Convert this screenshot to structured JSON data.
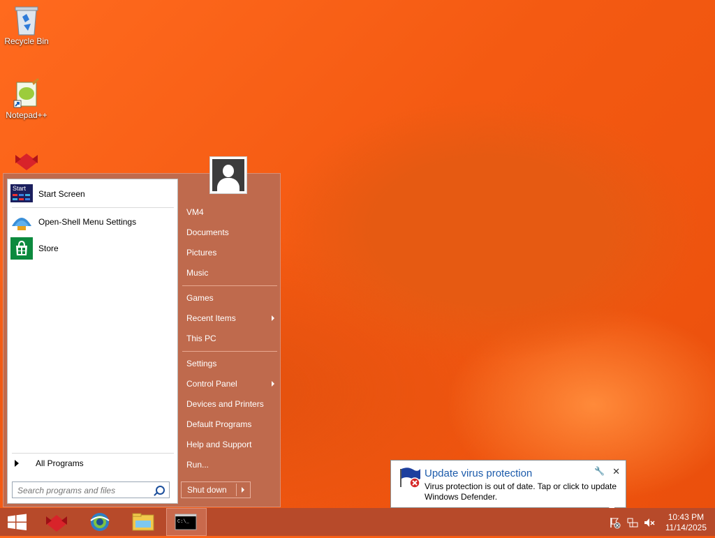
{
  "desktop": {
    "icons": [
      {
        "label": "Recycle Bin",
        "icon": "recycle-bin-icon"
      },
      {
        "label": "Notepad++",
        "icon": "notepad-plus-plus-icon"
      },
      {
        "label": "",
        "icon": "app-red-icon"
      }
    ]
  },
  "start_menu": {
    "pinned": [
      {
        "label": "Start Screen",
        "icon": "start-screen-icon"
      },
      {
        "label": "Open-Shell Menu Settings",
        "icon": "open-shell-icon"
      },
      {
        "label": "Store",
        "icon": "store-icon"
      }
    ],
    "start_tile_text": "Start",
    "all_programs": "All Programs",
    "search_placeholder": "Search programs and files",
    "right_items": [
      {
        "label": "VM4",
        "submenu": false
      },
      {
        "label": "Documents",
        "submenu": false
      },
      {
        "label": "Pictures",
        "submenu": false
      },
      {
        "label": "Music",
        "submenu": false
      },
      {
        "label": "Games",
        "submenu": false
      },
      {
        "label": "Recent Items",
        "submenu": true
      },
      {
        "label": "This PC",
        "submenu": false
      },
      {
        "label": "Settings",
        "submenu": false
      },
      {
        "label": "Control Panel",
        "submenu": true
      },
      {
        "label": "Devices and Printers",
        "submenu": false
      },
      {
        "label": "Default Programs",
        "submenu": false
      },
      {
        "label": "Help and Support",
        "submenu": false
      },
      {
        "label": "Run...",
        "submenu": false
      }
    ],
    "shutdown_label": "Shut down",
    "user_icon": "user-avatar-icon"
  },
  "notification": {
    "title": "Update virus protection",
    "message": "Virus protection is out of date. Tap or click to update Windows Defender.",
    "icon": "defender-warning-icon"
  },
  "taskbar": {
    "buttons": [
      "windows-start-icon",
      "app-red-icon",
      "browser-icon",
      "file-explorer-icon",
      "command-prompt-icon"
    ],
    "clock_time": "10:43 PM",
    "clock_date": "11/14/2025",
    "cmd_text": "C:\\_"
  },
  "colors": {
    "menu_bg": "#bf6a4d",
    "taskbar_bg": "#b74a2a",
    "accent_blue": "#1c5bab"
  }
}
